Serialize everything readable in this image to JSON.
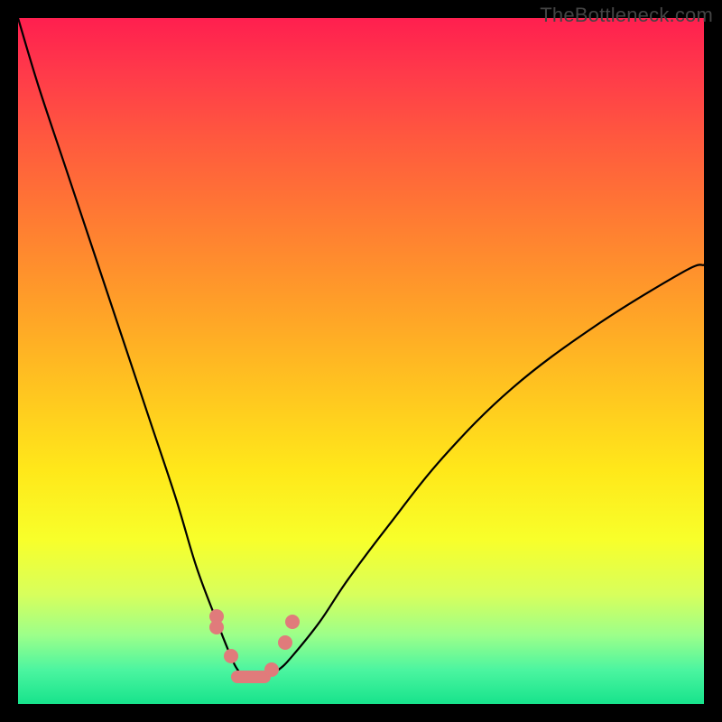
{
  "watermark_text": "TheBottleneck.com",
  "colors": {
    "marker": "#e07b7b",
    "curve": "#000000"
  },
  "chart_data": {
    "type": "line",
    "title": "",
    "xlabel": "",
    "ylabel": "",
    "xlim": [
      0,
      100
    ],
    "ylim": [
      0,
      100
    ],
    "grid": false,
    "legend": false,
    "annotations": [
      "TheBottleneck.com"
    ],
    "note": "Background vertical gradient red→yellow→green top→bottom. Curve is a V-shape with a flat trough; trough decorated with salmon capsule markers. Values estimated from pixel positions (0 bottom-left).",
    "series": [
      {
        "name": "bottleneck-curve",
        "x": [
          0,
          3,
          7,
          11,
          15,
          19,
          23,
          26,
          29,
          31,
          32,
          33,
          34,
          36,
          38,
          40,
          44,
          48,
          54,
          62,
          72,
          84,
          97,
          100
        ],
        "y": [
          100,
          90,
          78,
          66,
          54,
          42,
          30,
          20,
          12,
          7,
          5,
          4,
          4,
          4,
          5,
          7,
          12,
          18,
          26,
          36,
          46,
          55,
          63,
          64
        ]
      }
    ],
    "trough_markers": {
      "note": "Salmon capsule/dot markers near the curve minimum",
      "points": [
        {
          "x": 29,
          "y": 12,
          "shape": "dot-pair-vertical"
        },
        {
          "x": 31,
          "y": 7,
          "shape": "dot"
        },
        {
          "x": 34,
          "y": 4,
          "shape": "pill"
        },
        {
          "x": 37,
          "y": 5,
          "shape": "dot"
        },
        {
          "x": 39,
          "y": 9,
          "shape": "dot"
        },
        {
          "x": 40,
          "y": 12,
          "shape": "dot"
        }
      ]
    }
  }
}
